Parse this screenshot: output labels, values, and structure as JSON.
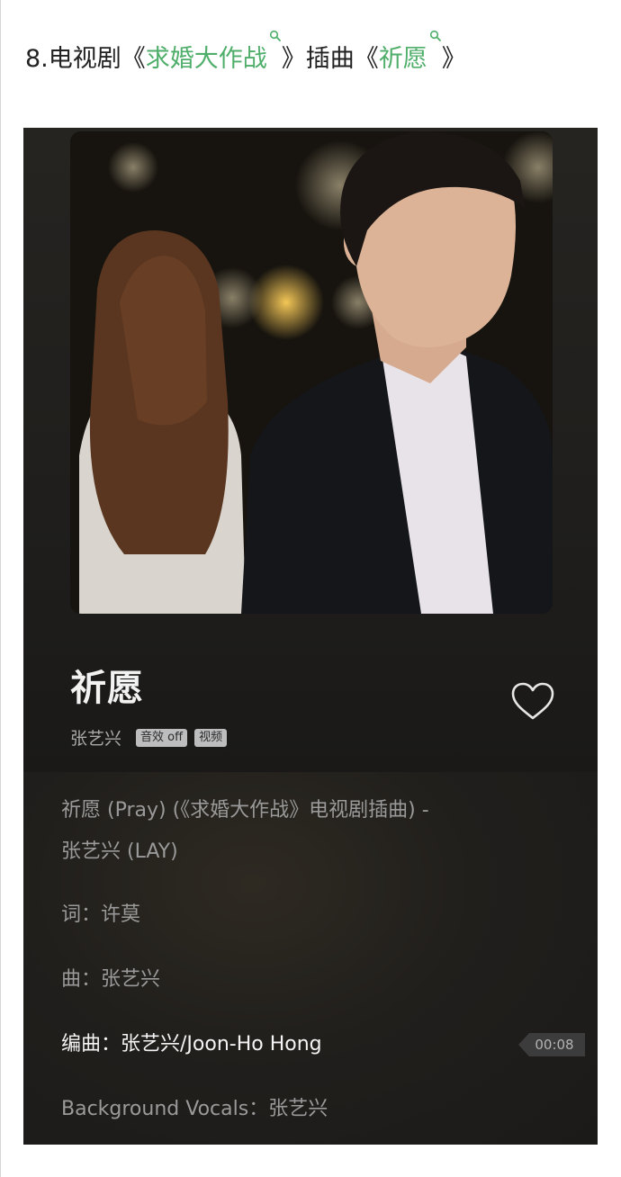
{
  "heading": {
    "prefix": "8.电视剧《",
    "drama_link": "求婚大作战",
    "mid": "》插曲《",
    "song_link": "祈愿",
    "suffix": "》"
  },
  "player": {
    "song_title": "祈愿",
    "artist": "张艺兴",
    "tags": [
      "音效 off",
      "视频"
    ],
    "lyrics": [
      "祈愿 (Pray) (《求婚大作战》电视剧插曲) -",
      "张艺兴 (LAY)",
      "词：许莫",
      "曲：张艺兴",
      "编曲：张艺兴/Joon-Ho Hong",
      "Background Vocals：张艺兴"
    ],
    "active_lyric_index": 4,
    "timestamp": "00:08"
  },
  "colors": {
    "link": "#4fae6a",
    "card_bg": "#1c1c1c",
    "active_lyric": "#f4f4f4",
    "lyric": "#9a9a9a"
  },
  "icons": [
    "search-icon",
    "heart-icon"
  ]
}
